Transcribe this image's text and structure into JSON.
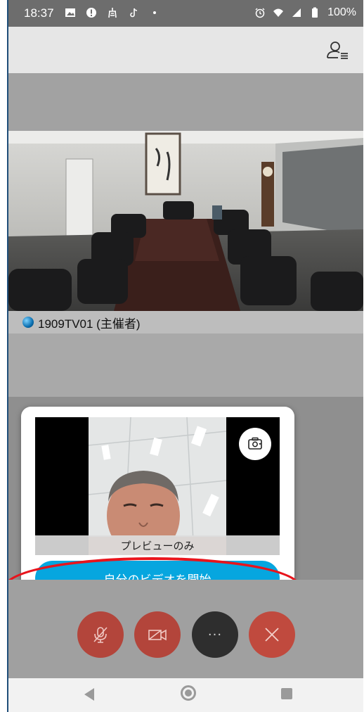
{
  "status_bar": {
    "time": "18:37",
    "battery": "100%",
    "left_icons": [
      "gallery-icon",
      "alert-icon",
      "hotspot-icon",
      "tiktok-icon",
      "dot-icon"
    ],
    "right_icons": [
      "alarm-icon",
      "wifi-icon",
      "signal-icon",
      "battery-icon"
    ]
  },
  "header": {
    "participants_icon": "participants-icon"
  },
  "main_video": {
    "participant_name": "1909TV01 (主催者)"
  },
  "preview_popup": {
    "preview_label": "プレビューのみ",
    "switch_camera_icon": "switch-camera-icon",
    "start_video_label": "自分のビデオを開始"
  },
  "controls": {
    "mute_icon": "microphone-muted-icon",
    "video_icon": "video-off-icon",
    "more_label": "···",
    "leave_icon": "close-icon"
  },
  "colors": {
    "accent_blue": "#06a6df",
    "control_red": "#b3453b",
    "highlight_red": "#e8141c"
  },
  "nav_bar": {
    "icons": [
      "back-icon",
      "home-icon",
      "recents-icon"
    ]
  }
}
